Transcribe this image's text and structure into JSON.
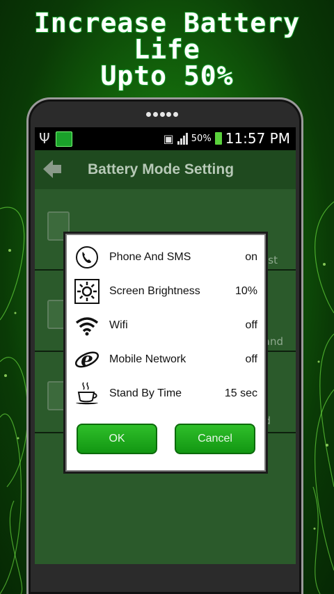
{
  "promo": {
    "line1": "Increase Battery",
    "line2": "Life",
    "line3": "Upto 50%"
  },
  "statusbar": {
    "battery_percent": "50%",
    "time": "11:57 PM"
  },
  "appbar": {
    "title": "Battery Mode Setting",
    "back_icon": "back-arrow-icon"
  },
  "background_rows": [
    {
      "fragment": "est"
    },
    {
      "fragment": "and"
    },
    {
      "fragment": "d"
    }
  ],
  "dialog": {
    "rows": [
      {
        "icon": "phone-icon",
        "label": "Phone And SMS",
        "value": "on"
      },
      {
        "icon": "brightness-icon",
        "label": "Screen Brightness",
        "value": "10%"
      },
      {
        "icon": "wifi-icon",
        "label": "Wifi",
        "value": "off"
      },
      {
        "icon": "mobile-network-icon",
        "label": "Mobile Network",
        "value": "off"
      },
      {
        "icon": "coffee-cup-icon",
        "label": "Stand By Time",
        "value": "15 sec"
      }
    ],
    "ok_label": "OK",
    "cancel_label": "Cancel"
  },
  "colors": {
    "accent_green": "#1aa21a",
    "background_green": "#146b0c"
  }
}
